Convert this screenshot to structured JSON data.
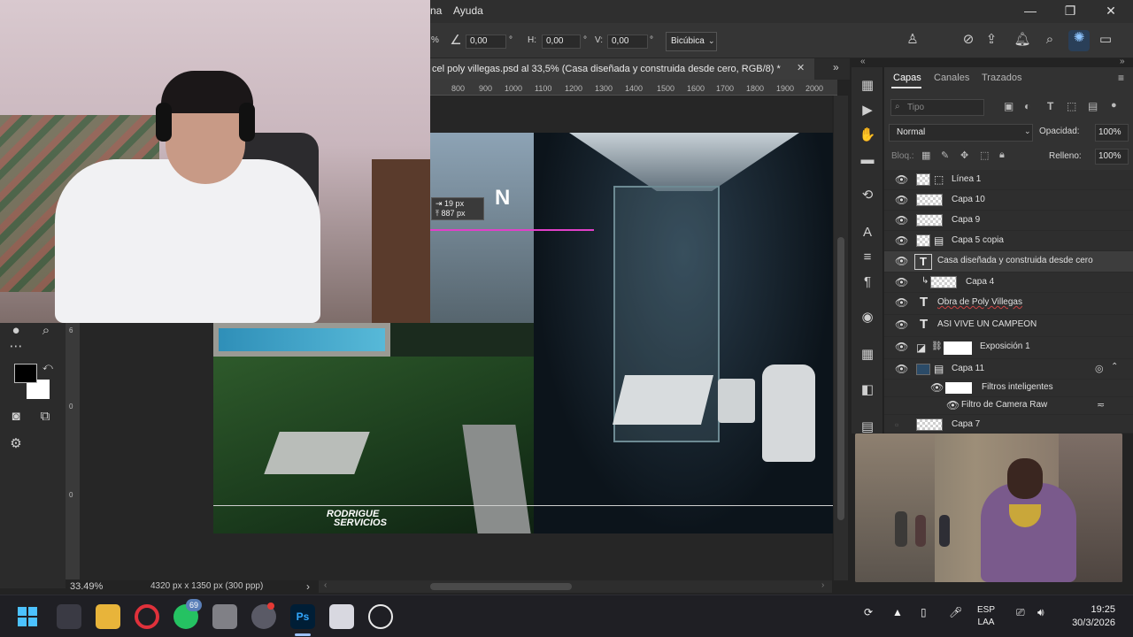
{
  "menu": {
    "ayuda": "Ayuda",
    "partial_item": "na"
  },
  "options": {
    "pct_fragment": "%",
    "angle_value": "0,00",
    "angle_unit": "°",
    "h_label": "H:",
    "h_value": "0,00",
    "h_unit": "°",
    "v_label": "V:",
    "v_value": "0,00",
    "v_unit": "°",
    "interpolation": "Bicúbica"
  },
  "document": {
    "tab_title": "cel poly villegas.psd al 33,5% (Casa diseñada y construida desde cero, RGB/8) *",
    "close": "✕",
    "ruler_ticks": [
      "800",
      "900",
      "1000",
      "1100",
      "1200",
      "1300",
      "1400",
      "1500",
      "1600",
      "1700",
      "1800",
      "1900",
      "2000"
    ],
    "ruler_left_ticks": [
      "6",
      "0",
      "0"
    ],
    "measure_w": "19 px",
    "measure_h": "887 px",
    "art_heading_fragment": "N",
    "brand_line1": "RODRIGUE",
    "brand_line2": "SERVICIOS"
  },
  "status": {
    "zoom": "33.49%",
    "dimensions": "4320 px x 1350 px (300 ppp)",
    "arrow": "›"
  },
  "panels": {
    "tabs": [
      "Capas",
      "Canales",
      "Trazados"
    ],
    "search_placeholder": "Tipo",
    "blend_mode": "Normal",
    "opacity_label": "Opacidad:",
    "opacity_value": "100%",
    "lock_label": "Bloq.:",
    "fill_label": "Relleno:",
    "fill_value": "100%"
  },
  "layers": [
    {
      "name": "Línea 1",
      "kind": "shape"
    },
    {
      "name": "Capa 10",
      "kind": "pixel"
    },
    {
      "name": "Capa 9",
      "kind": "pixel"
    },
    {
      "name": "Capa 5 copia",
      "kind": "smart"
    },
    {
      "name": "Casa diseñada y construida desde cero",
      "kind": "text"
    },
    {
      "name": "Capa 4",
      "kind": "clipped"
    },
    {
      "name": "Obra de Poly Villegas",
      "kind": "text"
    },
    {
      "name": "ASI VIVE UN CAMPEON",
      "kind": "text"
    },
    {
      "name": "Exposición 1",
      "kind": "adjustment"
    },
    {
      "name": "Capa 11",
      "kind": "smart"
    },
    {
      "name": "Filtros inteligentes",
      "kind": "filter-group"
    },
    {
      "name": "Filtro de Camera Raw",
      "kind": "filter"
    },
    {
      "name": "Capa 7",
      "kind": "pixel"
    }
  ],
  "taskbar": {
    "whatsapp_badge": "69",
    "lang_top": "ESP",
    "lang_bottom": "LAA",
    "time": "19:25",
    "date": "30/3/2026"
  },
  "colors": {
    "accent": "#1e73e8",
    "panel_bg": "#323232",
    "guide": "#e040c8",
    "ps_blue": "#31a8ff"
  }
}
